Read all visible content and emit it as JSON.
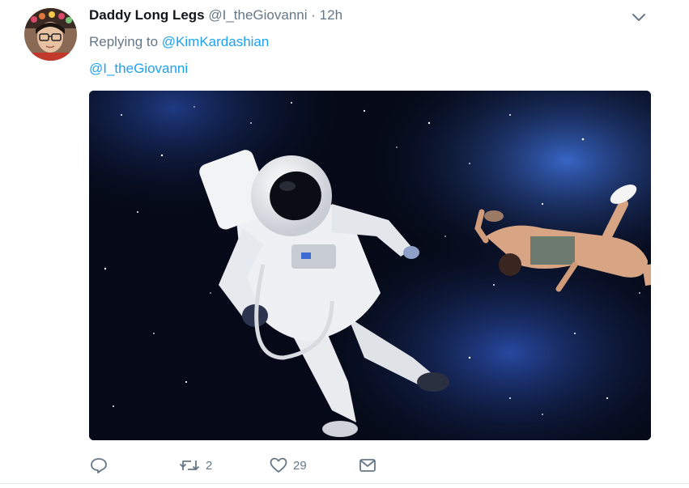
{
  "tweet": {
    "author_name": "Daddy Long Legs",
    "author_handle": "@I_theGiovanni",
    "separator": "·",
    "time": "12h",
    "replying_prefix": "Replying to",
    "replying_to": "@KimKardashian",
    "text_mention": "@I_theGiovanni",
    "media_alt": "",
    "actions": {
      "reply": {
        "icon": "reply-icon",
        "count": ""
      },
      "retweet": {
        "icon": "retweet-icon",
        "count": "2"
      },
      "like": {
        "icon": "heart-icon",
        "count": "29"
      },
      "dm": {
        "icon": "envelope-icon",
        "count": ""
      }
    }
  },
  "colors": {
    "link": "#1da1f2",
    "secondary_text": "#657786",
    "primary_text": "#14171a"
  }
}
